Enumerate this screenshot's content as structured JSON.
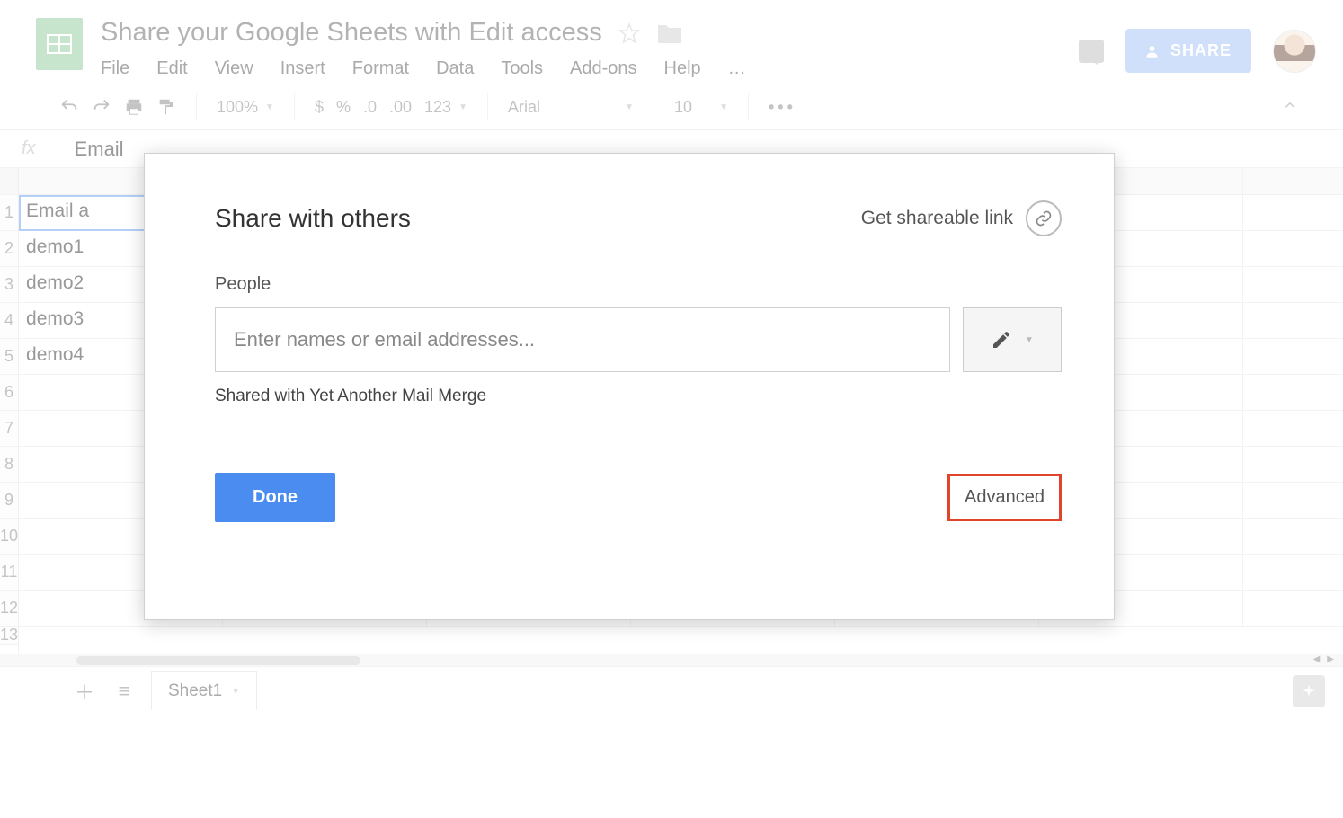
{
  "header": {
    "doc_title": "Share your Google Sheets with Edit access",
    "share_button": "SHARE"
  },
  "menubar": {
    "file": "File",
    "edit": "Edit",
    "view": "View",
    "insert": "Insert",
    "format": "Format",
    "data": "Data",
    "tools": "Tools",
    "addons": "Add-ons",
    "help": "Help",
    "more": "…"
  },
  "toolbar": {
    "zoom": "100%",
    "currency": "$",
    "percent": "%",
    "dec_less": ".0",
    "dec_more": ".00",
    "numfmt": "123",
    "font": "Arial",
    "font_size": "10",
    "more": "•••"
  },
  "formula_bar": {
    "fx": "fx",
    "value": "Email"
  },
  "grid": {
    "row_numbers": [
      "1",
      "2",
      "3",
      "4",
      "5",
      "6",
      "7",
      "8",
      "9",
      "10",
      "11",
      "12",
      "13"
    ],
    "rows": [
      {
        "a": "Email a"
      },
      {
        "a": "demo1"
      },
      {
        "a": "demo2"
      },
      {
        "a": "demo3"
      },
      {
        "a": "demo4"
      },
      {
        "a": ""
      },
      {
        "a": ""
      },
      {
        "a": ""
      },
      {
        "a": ""
      },
      {
        "a": ""
      },
      {
        "a": ""
      },
      {
        "a": ""
      },
      {
        "a": ""
      }
    ]
  },
  "tabs": {
    "sheet1": "Sheet1"
  },
  "modal": {
    "title": "Share with others",
    "get_link": "Get shareable link",
    "people_label": "People",
    "people_placeholder": "Enter names or email addresses...",
    "shared_with": "Shared with Yet Another Mail Merge",
    "done": "Done",
    "advanced": "Advanced"
  }
}
